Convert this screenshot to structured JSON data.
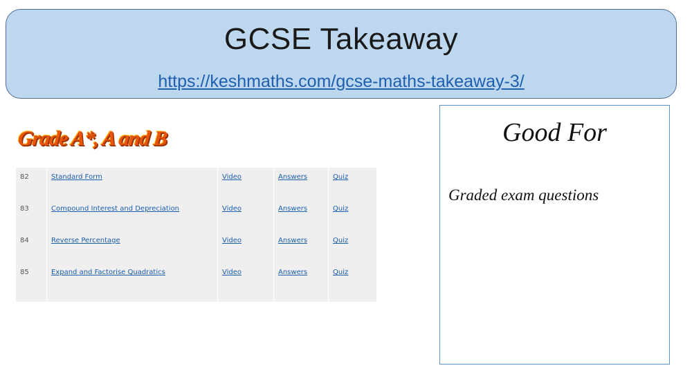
{
  "banner": {
    "title": "GCSE Takeaway",
    "link": "https://keshmaths.com/gcse-maths-takeaway-3/"
  },
  "grade_heading": {
    "prefix": "Grade A*,",
    "suffix": " A and B"
  },
  "topics": [
    {
      "num": "82",
      "topic": "Standard Form",
      "video": "Video",
      "answers": "Answers",
      "quiz": "Quiz"
    },
    {
      "num": "83",
      "topic": "Compound Interest and Depreciation",
      "video": "Video",
      "answers": "Answers",
      "quiz": "Quiz"
    },
    {
      "num": "84",
      "topic": "Reverse Percentage",
      "video": "Video",
      "answers": "Answers",
      "quiz": "Quiz"
    },
    {
      "num": "85",
      "topic": "Expand and Factorise Quadratics",
      "video": "Video",
      "answers": "Answers",
      "quiz": "Quiz"
    }
  ],
  "good_for": {
    "title": "Good For",
    "text": "Graded exam questions"
  },
  "colors": {
    "banner_bg": "#bdd7ee",
    "link": "#1a5dab",
    "grade_heading": "#f07a12",
    "box_border": "#5b8fcc"
  }
}
